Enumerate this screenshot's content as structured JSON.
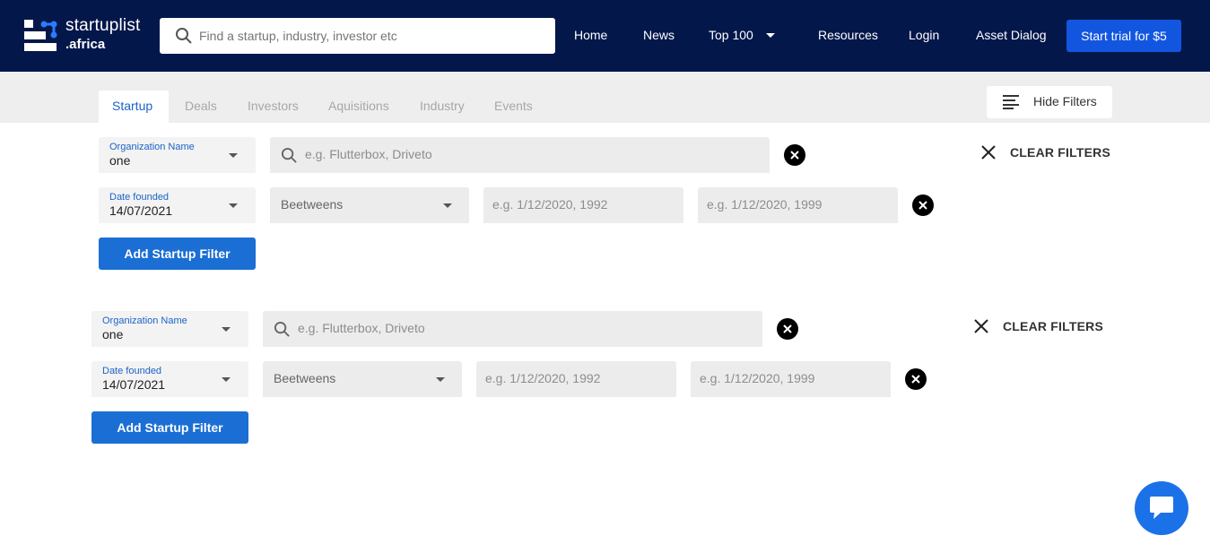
{
  "brand": {
    "name_line1": "startuplist",
    "name_line2": ".africa"
  },
  "search": {
    "placeholder": "Find a startup, industry, investor etc"
  },
  "nav": {
    "home": "Home",
    "news": "News",
    "top100": "Top 100",
    "resources": "Resources",
    "login": "Login",
    "asset_dialog": "Asset Dialog",
    "trial": "Start trial for $5"
  },
  "tabs": [
    {
      "label": "Startup",
      "active": true
    },
    {
      "label": "Deals"
    },
    {
      "label": "Investors"
    },
    {
      "label": "Aquisitions"
    },
    {
      "label": "Industry"
    },
    {
      "label": "Events"
    }
  ],
  "hide_filters": "Hide Filters",
  "filter_groups": [
    {
      "org_label": "Organization Name",
      "org_value": "one",
      "org_placeholder": "e.g. Flutterbox, Driveto",
      "date_label": "Date founded",
      "date_value": "14/07/2021",
      "between": "Beetweens",
      "from_placeholder": "e.g. 1/12/2020, 1992",
      "to_placeholder": "e.g. 1/12/2020, 1999",
      "clear": "CLEAR FILTERS",
      "add": "Add Startup Filter"
    },
    {
      "org_label": "Organization Name",
      "org_value": "one",
      "org_placeholder": "e.g. Flutterbox, Driveto",
      "date_label": "Date founded",
      "date_value": "14/07/2021",
      "between": "Beetweens",
      "from_placeholder": "e.g. 1/12/2020, 1992",
      "to_placeholder": "e.g. 1/12/2020, 1999",
      "clear": "CLEAR FILTERS",
      "add": "Add Startup Filter"
    }
  ],
  "colors": {
    "header": "#03174b",
    "primary": "#1256e0",
    "button": "#1b6fd4",
    "tab_active": "#1b63c6"
  },
  "icons": [
    "logo-mark-icon",
    "search-icon",
    "caret-down-icon",
    "hide-filters-icon",
    "close-circle-icon",
    "close-icon",
    "chat-icon"
  ]
}
